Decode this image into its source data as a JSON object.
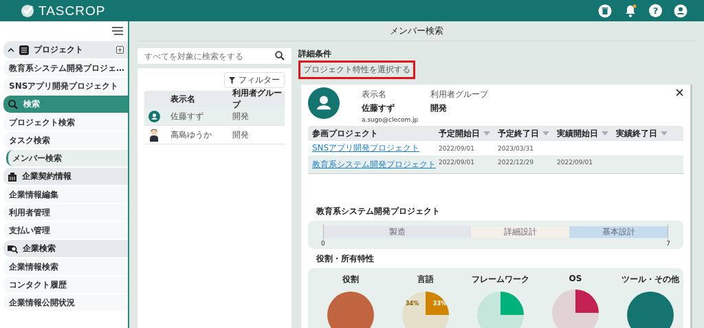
{
  "header": {
    "logo": "TASCROP",
    "help": "?",
    "notification": true
  },
  "sidebar": {
    "groups": [
      {
        "label": "プロジェクト",
        "expanded": true,
        "active": false,
        "add": true,
        "items": [
          {
            "label": "教育系システム開発プロジェ…",
            "selected": false
          },
          {
            "label": "SNSアプリ開発プロジェクト",
            "selected": false
          }
        ]
      },
      {
        "label": "検索",
        "active": true,
        "add": false,
        "items": [
          {
            "label": "プロジェクト検索",
            "selected": false
          },
          {
            "label": "タスク検索",
            "selected": false
          },
          {
            "label": "メンバー検索",
            "selected": true
          }
        ]
      },
      {
        "label": "企業契約情報",
        "active": false,
        "add": false,
        "items": [
          {
            "label": "企業情報編集",
            "selected": false
          },
          {
            "label": "利用者管理",
            "selected": false
          },
          {
            "label": "支払い管理",
            "selected": false
          }
        ]
      },
      {
        "label": "企業検索",
        "active": false,
        "add": false,
        "items": [
          {
            "label": "企業情報検索",
            "selected": false
          },
          {
            "label": "コンタクト履歴",
            "selected": false
          },
          {
            "label": "企業情報公開状況",
            "selected": false
          }
        ]
      }
    ]
  },
  "page_title": "メンバー検索",
  "search": {
    "placeholder": "すべてを対象に検索をする"
  },
  "filter_button": "フィルター",
  "members": {
    "columns": [
      "表示名",
      "利用者グループ"
    ],
    "rows": [
      {
        "name": "佐藤すず",
        "group": "開発",
        "kind": "default",
        "selected": true
      },
      {
        "name": "高島ゆうか",
        "group": "開発",
        "kind": "illustration",
        "selected": false
      }
    ]
  },
  "detail_conditions": {
    "label": "詳細条件",
    "button": "プロジェクト特性を選択する"
  },
  "detail": {
    "name_label": "表示名",
    "group_label": "利用者グループ",
    "name": "佐藤すず",
    "group": "開発",
    "email": "a.sugo@clecom.jp",
    "columns": [
      "参画プロジェクト",
      "予定開始日",
      "予定終了日",
      "実績開始日",
      "実績終了日"
    ],
    "rows": [
      [
        "SNSアプリ開発プロジェクト",
        "2022/09/01",
        "2023/03/31",
        ""
      ],
      [
        "教育系システム開発プロジェクト",
        "2022/09/01",
        "2022/12/29",
        "2022/09/01"
      ]
    ],
    "chart_data": {
      "type": "bar",
      "orientation": "horizontal",
      "stacked": true,
      "title": "教育系システム開発プロジェクト",
      "xlim": [
        0,
        7
      ],
      "xticks": [
        0,
        7
      ],
      "series": [
        {
          "name": "製造",
          "color": "#e2e6ec",
          "values": [
            3
          ]
        },
        {
          "name": "詳細設計",
          "color": "#f4efe9",
          "values": [
            2
          ]
        },
        {
          "name": "基本設計",
          "color": "#c4dcee",
          "values": [
            2
          ]
        }
      ]
    },
    "traits_title": "役割・所有特性",
    "pies": [
      {
        "title": "役割",
        "kind": "single",
        "color": "#c0653f"
      },
      {
        "title": "言語",
        "kind": "split",
        "color": "#d18400",
        "labels": [
          "34%",
          "33%"
        ]
      },
      {
        "title": "フレームワーク",
        "kind": "split",
        "color": "#00b27a"
      },
      {
        "title": "OS",
        "kind": "split",
        "color": "#c22152"
      },
      {
        "title": "ツール・その他",
        "kind": "single",
        "color": "#14746f"
      }
    ]
  }
}
